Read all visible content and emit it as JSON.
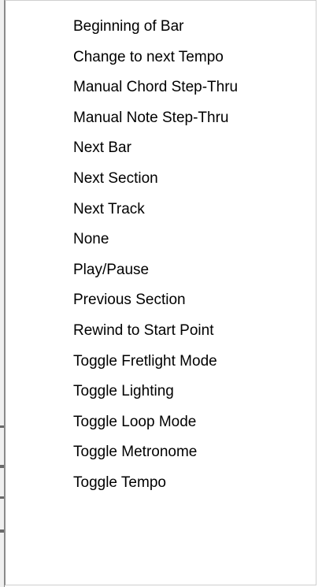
{
  "menu": {
    "items": [
      {
        "label": "Beginning of Bar"
      },
      {
        "label": "Change to next Tempo"
      },
      {
        "label": "Manual Chord Step-Thru"
      },
      {
        "label": "Manual Note Step-Thru"
      },
      {
        "label": "Next Bar"
      },
      {
        "label": "Next Section"
      },
      {
        "label": "Next Track"
      },
      {
        "label": "None"
      },
      {
        "label": "Play/Pause"
      },
      {
        "label": "Previous Section"
      },
      {
        "label": "Rewind to Start Point"
      },
      {
        "label": "Toggle Fretlight Mode"
      },
      {
        "label": "Toggle Lighting"
      },
      {
        "label": "Toggle Loop Mode"
      },
      {
        "label": "Toggle Metronome"
      },
      {
        "label": "Toggle Tempo"
      }
    ]
  }
}
